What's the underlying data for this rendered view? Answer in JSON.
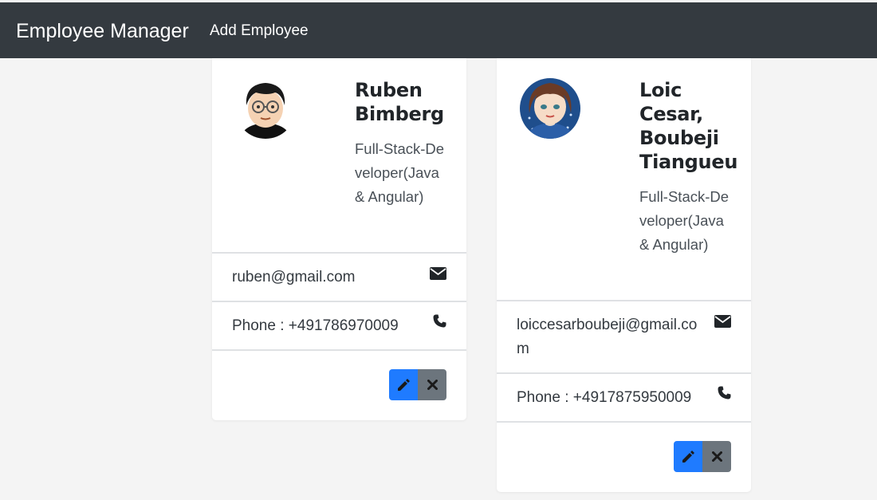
{
  "navbar": {
    "brand": "Employee Manager",
    "add_employee": "Add Employee",
    "background": "#343a40"
  },
  "employees": [
    {
      "name": "Ruben Bimberg",
      "job_title": "Full-Stack-Developer(Java & Angular)",
      "email": "ruben@gmail.com",
      "phone_label": "Phone : +491786970009",
      "avatar_icon": "avatar-glasses-man",
      "email_icon": "envelope-icon",
      "phone_icon": "phone-icon",
      "edit_icon": "pencil-icon",
      "delete_icon": "close-icon"
    },
    {
      "name": "Loic Cesar, Boubeji Tiangueu",
      "job_title": "Full-Stack-Developer(Java & Angular)",
      "email": "loiccesarboubeji@gmail.com",
      "phone_label": "Phone : +4917875950009",
      "avatar_icon": "avatar-woman",
      "email_icon": "envelope-icon",
      "phone_icon": "phone-icon",
      "edit_icon": "pencil-icon",
      "delete_icon": "close-icon"
    }
  ],
  "colors": {
    "edit_button": "#1f7bff",
    "delete_button": "#6c757d",
    "page_background": "#f4f4f4"
  }
}
